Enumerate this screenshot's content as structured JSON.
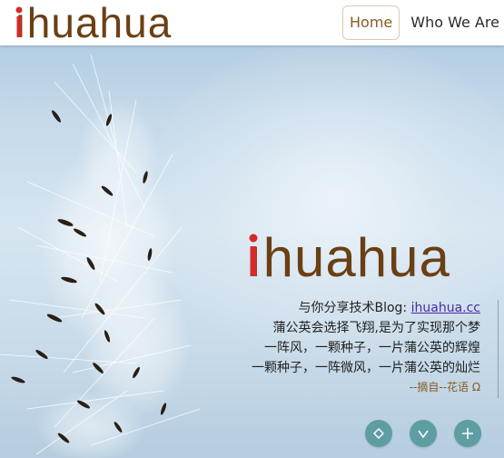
{
  "header": {
    "logo_text": "ihuahua",
    "nav": [
      {
        "label": "Home",
        "active": true
      },
      {
        "label": "Who We Are",
        "active": false
      }
    ]
  },
  "hero": {
    "logo_text": "ihuahua",
    "quote": {
      "intro": "与你分享技术Blog: ",
      "link_text": "ihuahua.cc",
      "lines": [
        "蒲公英会选择飞翔,是为了实现那个梦",
        "一阵风，一颗种子，一片蒲公英的辉煌",
        "一颗种子，一阵微风，一片蒲公英的灿烂"
      ],
      "source": "--摘自--花语 Ω"
    }
  },
  "controls": {
    "icons": [
      "diamond-icon",
      "chevron-down-icon",
      "plus-icon"
    ]
  },
  "colors": {
    "brand_brown": "#6b3f14",
    "brand_red": "#d42a2a",
    "active_nav": "#8a5a22",
    "button_teal": "#5e9ea3",
    "link": "#4a2aa5"
  }
}
